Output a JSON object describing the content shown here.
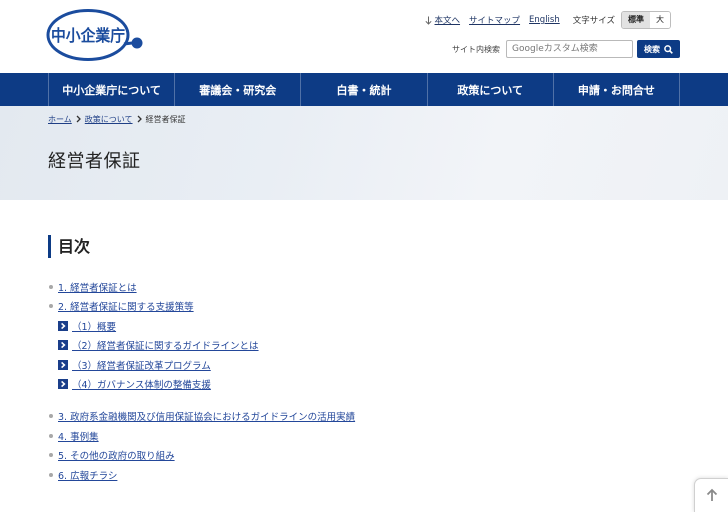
{
  "logo": {
    "text": "中小企業庁"
  },
  "utility": {
    "skip_label": "本文へ",
    "sitemap_label": "サイトマップ",
    "english_label": "English",
    "font_size_label": "文字サイズ",
    "font_size_options": [
      {
        "label": "標準",
        "selected": true
      },
      {
        "label": "大",
        "selected": false
      }
    ]
  },
  "search": {
    "label": "サイト内検索",
    "placeholder": "Googleカスタム検索",
    "value": "",
    "button_label": "検索"
  },
  "nav": {
    "items": [
      {
        "label": "中小企業庁について"
      },
      {
        "label": "審議会・研究会"
      },
      {
        "label": "白書・統計"
      },
      {
        "label": "政策について"
      },
      {
        "label": "申請・お問合せ"
      }
    ]
  },
  "breadcrumb": {
    "items": [
      {
        "label": "ホーム",
        "link": true
      },
      {
        "label": "政策について",
        "link": true
      },
      {
        "label": "経営者保証",
        "link": false
      }
    ]
  },
  "page_title": "経営者保証",
  "toc": {
    "heading": "目次",
    "items": [
      {
        "label": "1. 経営者保証とは"
      },
      {
        "label": "2. 経営者保証に関する支援策等",
        "children": [
          {
            "label": "（1）概要"
          },
          {
            "label": "（2）経営者保証に関するガイドラインとは"
          },
          {
            "label": "（3）経営者保証改革プログラム"
          },
          {
            "label": "（4）ガバナンス体制の整備支援"
          }
        ]
      },
      {
        "label": "3. 政府系金融機関及び信用保証協会におけるガイドラインの活用実績"
      },
      {
        "label": "4. 事例集"
      },
      {
        "label": "5. その他の政府の取り組み"
      },
      {
        "label": "6. 広報チラシ"
      }
    ]
  },
  "icons": {
    "skip": "arrow-down-icon",
    "search": "search-icon",
    "breadcrumb_separator": "chevron-right-icon",
    "toc_bullet": "bullet-dot-icon",
    "toc_subitem": "chevron-right-box-icon",
    "back_to_top": "arrow-up-icon"
  },
  "colors": {
    "brand_blue": "#0d3b85",
    "logo_blue": "#1b4c9e",
    "link": "#23479a",
    "bullet": "#a8a8a8",
    "page_head_bg": "#e9eef4"
  }
}
